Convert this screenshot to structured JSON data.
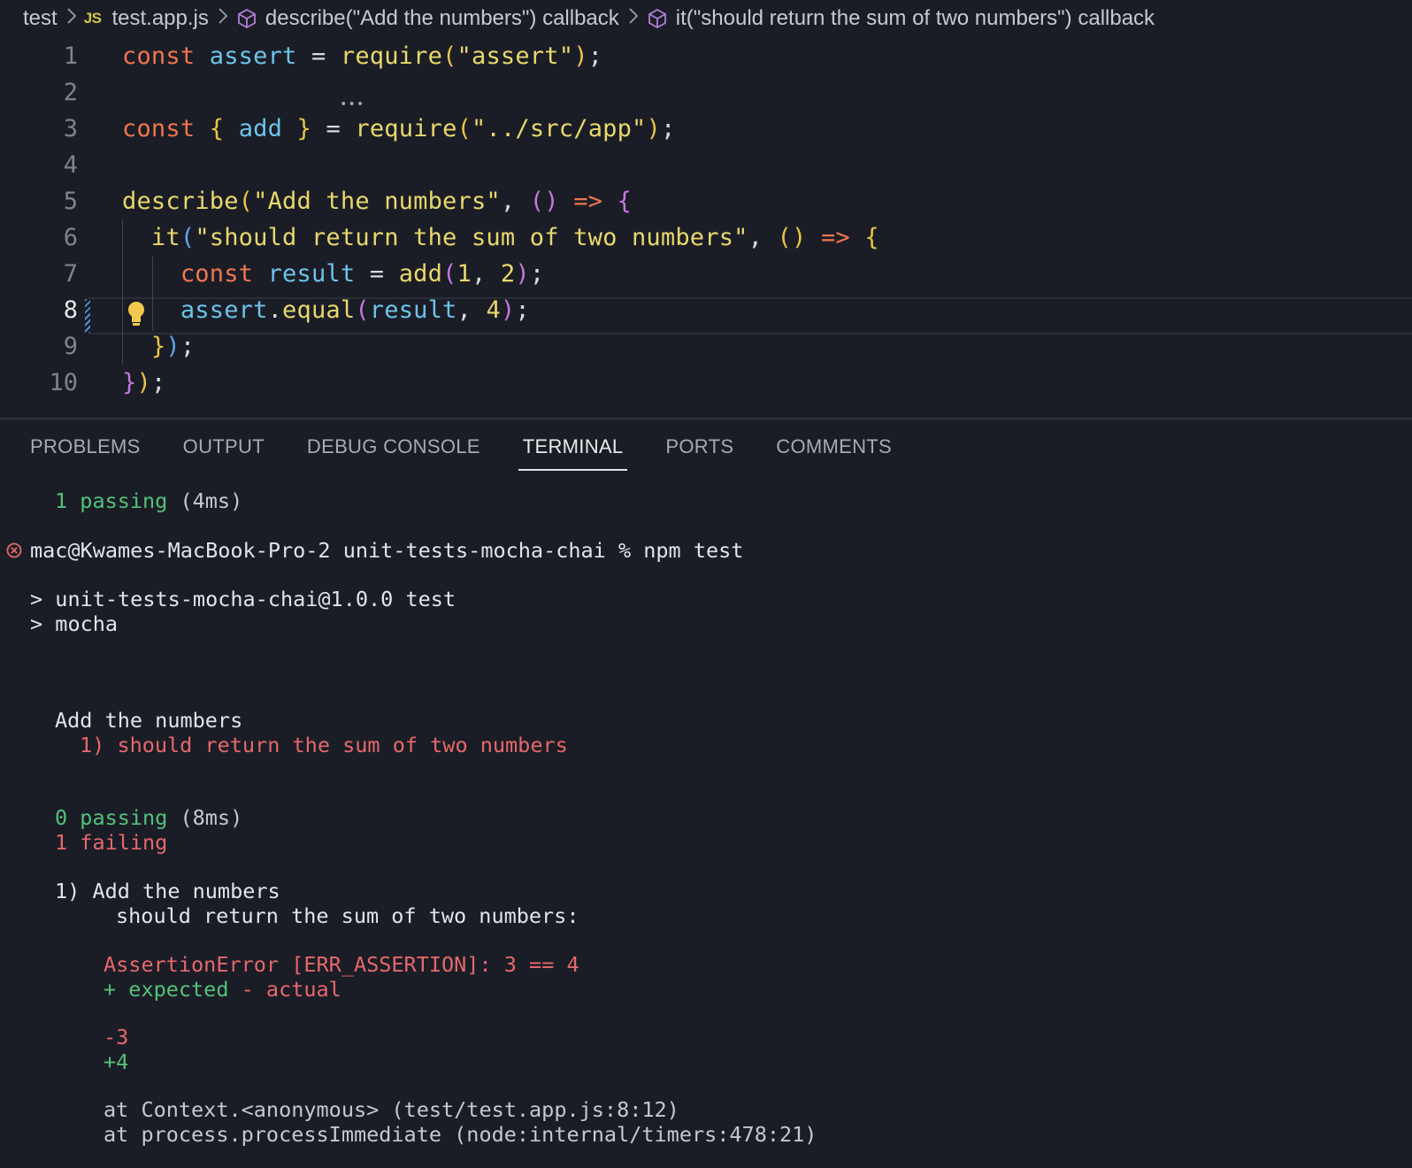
{
  "breadcrumb": {
    "folder": "test",
    "file_badge": "JS",
    "file": "test.app.js",
    "scope1": "describe(\"Add the numbers\") callback",
    "scope2": "it(\"should return the sum of two numbers\") callback"
  },
  "editor": {
    "line_numbers": [
      "1",
      "2",
      "3",
      "4",
      "5",
      "6",
      "7",
      "8",
      "9",
      "10"
    ],
    "active_line": "8",
    "tokens": {
      "const": "const",
      "assert": "assert",
      "eq": " = ",
      "require": "require",
      "assert_str": "\"assert\"",
      "add": "add",
      "app_str": "\"../src/app\"",
      "describe": "describe",
      "describe_str": "\"Add the numbers\"",
      "arrow": "=>",
      "it": "it",
      "it_str": "\"should return the sum of two numbers\"",
      "result": "result",
      "one": "1",
      "two": "2",
      "equal": "equal",
      "four": "4"
    }
  },
  "panel": {
    "tabs": [
      "PROBLEMS",
      "OUTPUT",
      "DEBUG CONSOLE",
      "TERMINAL",
      "PORTS",
      "COMMENTS"
    ],
    "active_tab": "TERMINAL"
  },
  "terminal": {
    "prev_passing_count": "1 passing",
    "prev_passing_time": " (4ms)",
    "prompt": "mac@Kwames-MacBook-Pro-2 unit-tests-mocha-chai % npm test",
    "npm_line1": "> unit-tests-mocha-chai@1.0.0 test",
    "npm_line2": "> mocha",
    "suite": "Add the numbers",
    "failed_test": "1) should return the sum of two numbers",
    "passing_count": "0 passing",
    "passing_time": " (8ms)",
    "failing": "1 failing",
    "fail_title": "1) Add the numbers",
    "fail_subtitle": "should return the sum of two numbers:",
    "assertion_error": "AssertionError [ERR_ASSERTION]: 3 == 4",
    "expected_label": "+ expected",
    "actual_label": " - actual",
    "minus_val": "-3",
    "plus_val": "+4",
    "stack1": "at Context.<anonymous> (test/test.app.js:8:12)",
    "stack2": "at process.processImmediate (node:internal/timers:478:21)"
  },
  "colors": {
    "background": "#1b1d26",
    "keyword": "#f0764e",
    "variable": "#6cc4ea",
    "function": "#e8d86c",
    "pass": "#53c17a",
    "fail": "#e5686b"
  }
}
